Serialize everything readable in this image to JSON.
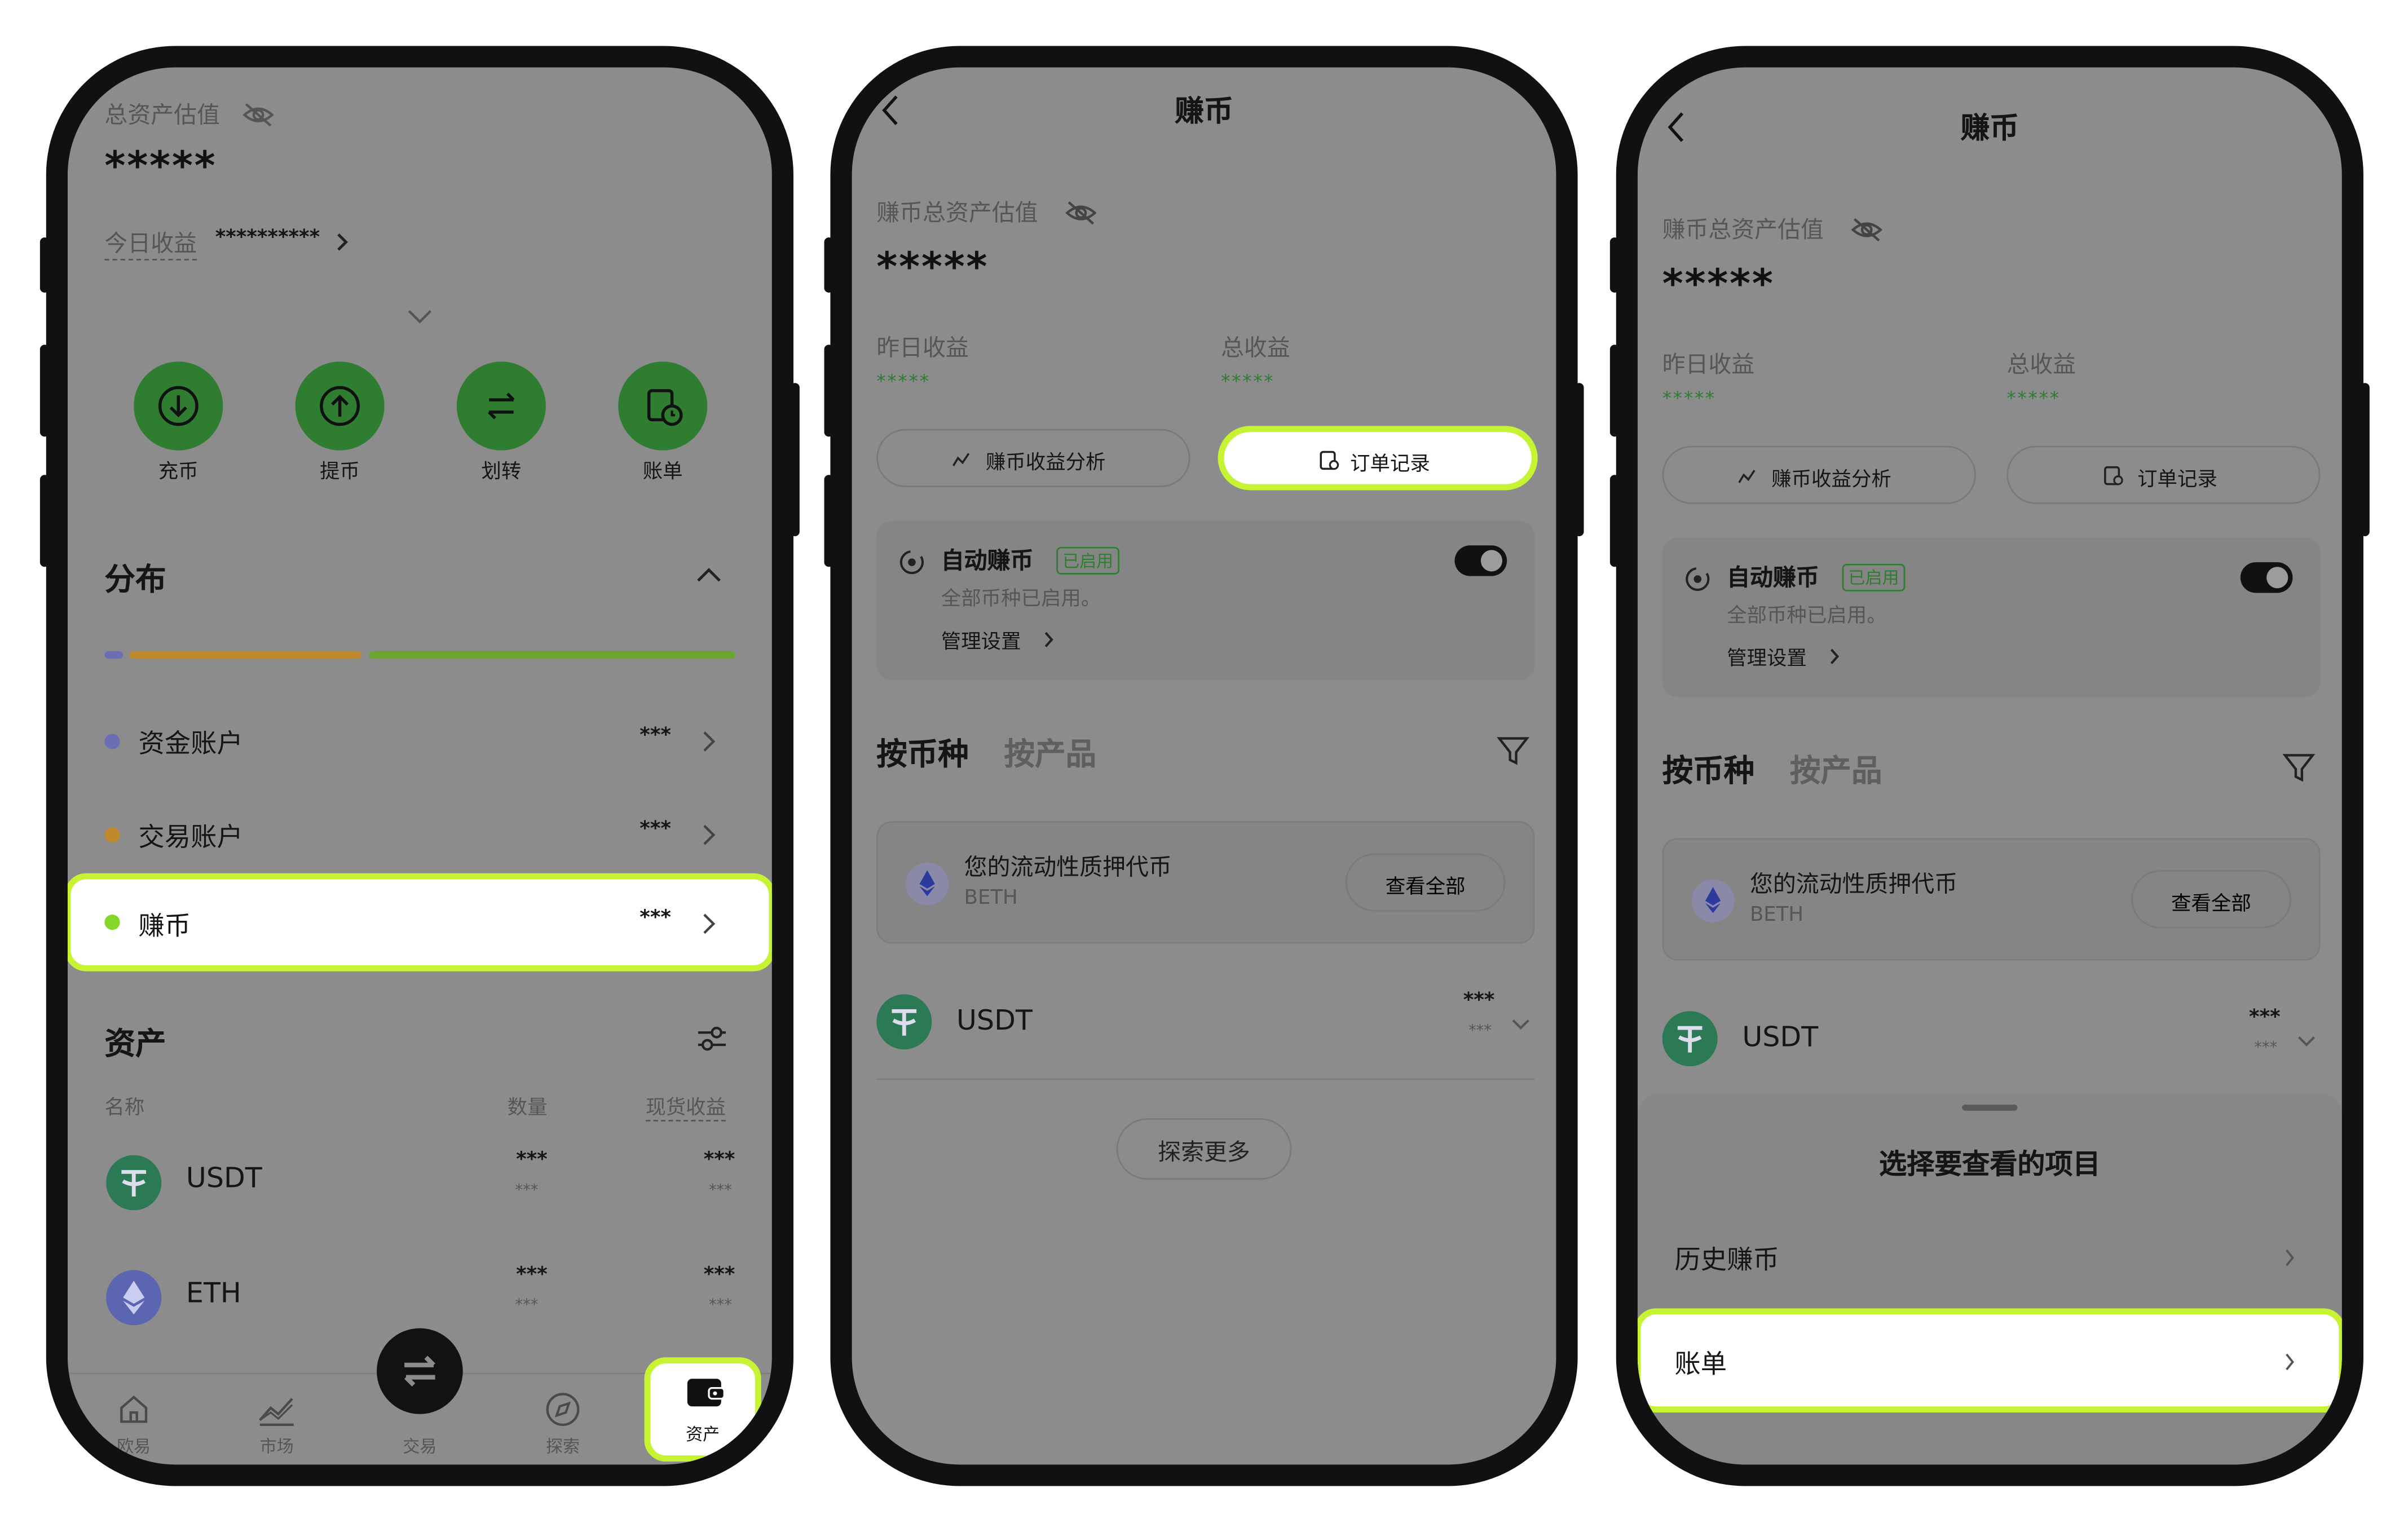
{
  "colors": {
    "highlight": "#c6f432",
    "overlay": "#8c8c8c",
    "accent_green": "#2f7d31",
    "stars_green": "#2e7d32",
    "bar_blue": "#6a6fb5",
    "bar_orange": "#c08a2c",
    "bar_green": "#6aa52d"
  },
  "s1": {
    "total_label": "总资产估值",
    "total_value": "*****",
    "today_label": "今日收益",
    "today_value": "**********",
    "actions": [
      "充币",
      "提币",
      "划转",
      "账单"
    ],
    "dist_title": "分布",
    "accounts": [
      {
        "label": "资金账户",
        "value": "***"
      },
      {
        "label": "交易账户",
        "value": "***"
      },
      {
        "label": "赚币",
        "value": "***"
      }
    ],
    "assets_title": "资产",
    "cols": {
      "name": "名称",
      "qty": "数量",
      "pnl": "现货收益"
    },
    "assets": [
      {
        "name": "USDT",
        "qty": "***",
        "qty_sub": "***",
        "pnl": "***",
        "pnl_sub": "***"
      },
      {
        "name": "ETH",
        "qty": "***",
        "qty_sub": "***",
        "pnl": "***",
        "pnl_sub": "***"
      }
    ],
    "nav": [
      "欧易",
      "市场",
      "交易",
      "探索",
      "资产"
    ]
  },
  "s2": {
    "title": "赚币",
    "total_label": "赚币总资产估值",
    "total_value": "*****",
    "yest_label": "昨日收益",
    "yest_value": "*****",
    "total_earn_label": "总收益",
    "total_earn_value": "*****",
    "analysis_btn": "赚币收益分析",
    "orders_btn": "订单记录",
    "auto_title": "自动赚币",
    "auto_badge": "已启用",
    "auto_sub": "全部币种已启用。",
    "manage": "管理设置",
    "tab_coin": "按币种",
    "tab_product": "按产品",
    "lsd_title": "您的流动性质押代币",
    "lsd_sub": "BETH",
    "view_all": "查看全部",
    "usdt_name": "USDT",
    "usdt_val": "***",
    "usdt_sub": "***",
    "explore": "探索更多"
  },
  "s3": {
    "title": "赚币",
    "total_label": "赚币总资产估值",
    "total_value": "*****",
    "yest_label": "昨日收益",
    "yest_value": "*****",
    "total_earn_label": "总收益",
    "total_earn_value": "*****",
    "analysis_btn": "赚币收益分析",
    "orders_btn": "订单记录",
    "auto_title": "自动赚币",
    "auto_badge": "已启用",
    "auto_sub": "全部币种已启用。",
    "manage": "管理设置",
    "tab_coin": "按币种",
    "tab_product": "按产品",
    "lsd_title": "您的流动性质押代币",
    "lsd_sub": "BETH",
    "view_all": "查看全部",
    "usdt_name": "USDT",
    "usdt_val": "***",
    "usdt_sub": "***",
    "sheet_title": "选择要查看的项目",
    "sheet_items": [
      "历史赚币",
      "账单"
    ]
  }
}
